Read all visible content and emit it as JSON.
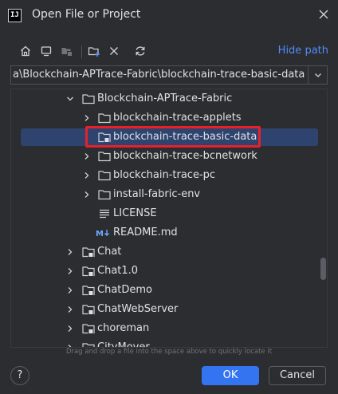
{
  "window": {
    "title": "Open File or Project",
    "logo_text": "IJ"
  },
  "toolbar": {
    "hide_path_label": "Hide path"
  },
  "path": {
    "value": "a\\Blockchain-APTrace-Fabric\\blockchain-trace-basic-data"
  },
  "tree": {
    "items": [
      {
        "label": "Blockchain-APTrace-Fabric",
        "icon": "folder-icon",
        "expanded": true,
        "selected": false
      },
      {
        "label": "blockchain-trace-applets",
        "icon": "folder-icon",
        "expanded": false,
        "selected": false
      },
      {
        "label": "blockchain-trace-basic-data",
        "icon": "module-folder-icon",
        "expanded": false,
        "selected": true
      },
      {
        "label": "blockchain-trace-bcnetwork",
        "icon": "folder-icon",
        "expanded": false,
        "selected": false
      },
      {
        "label": "blockchain-trace-pc",
        "icon": "folder-icon",
        "expanded": false,
        "selected": false
      },
      {
        "label": "install-fabric-env",
        "icon": "folder-icon",
        "expanded": false,
        "selected": false
      },
      {
        "label": "LICENSE",
        "icon": "text-file-icon",
        "selected": false
      },
      {
        "label": "README.md",
        "icon": "markdown-file-icon",
        "selected": false
      },
      {
        "label": "Chat",
        "icon": "module-folder-icon",
        "expanded": false,
        "selected": false
      },
      {
        "label": "Chat1.0",
        "icon": "module-folder-icon",
        "expanded": false,
        "selected": false
      },
      {
        "label": "ChatDemo",
        "icon": "module-folder-icon",
        "expanded": false,
        "selected": false
      },
      {
        "label": "ChatWebServer",
        "icon": "module-folder-icon",
        "expanded": false,
        "selected": false
      },
      {
        "label": "choreman",
        "icon": "module-folder-icon",
        "expanded": false,
        "selected": false
      },
      {
        "label": "CityMover",
        "icon": "module-folder-icon",
        "expanded": false,
        "selected": false
      }
    ]
  },
  "hint": "Drag and drop a file into the space above to quickly locate it",
  "footer": {
    "help_label": "?",
    "ok_label": "OK",
    "cancel_label": "Cancel"
  },
  "colors": {
    "background": "#2b2d30",
    "selection": "#2e436e",
    "accent": "#3574f0",
    "link": "#548af7",
    "highlight_box": "#e8202a"
  }
}
